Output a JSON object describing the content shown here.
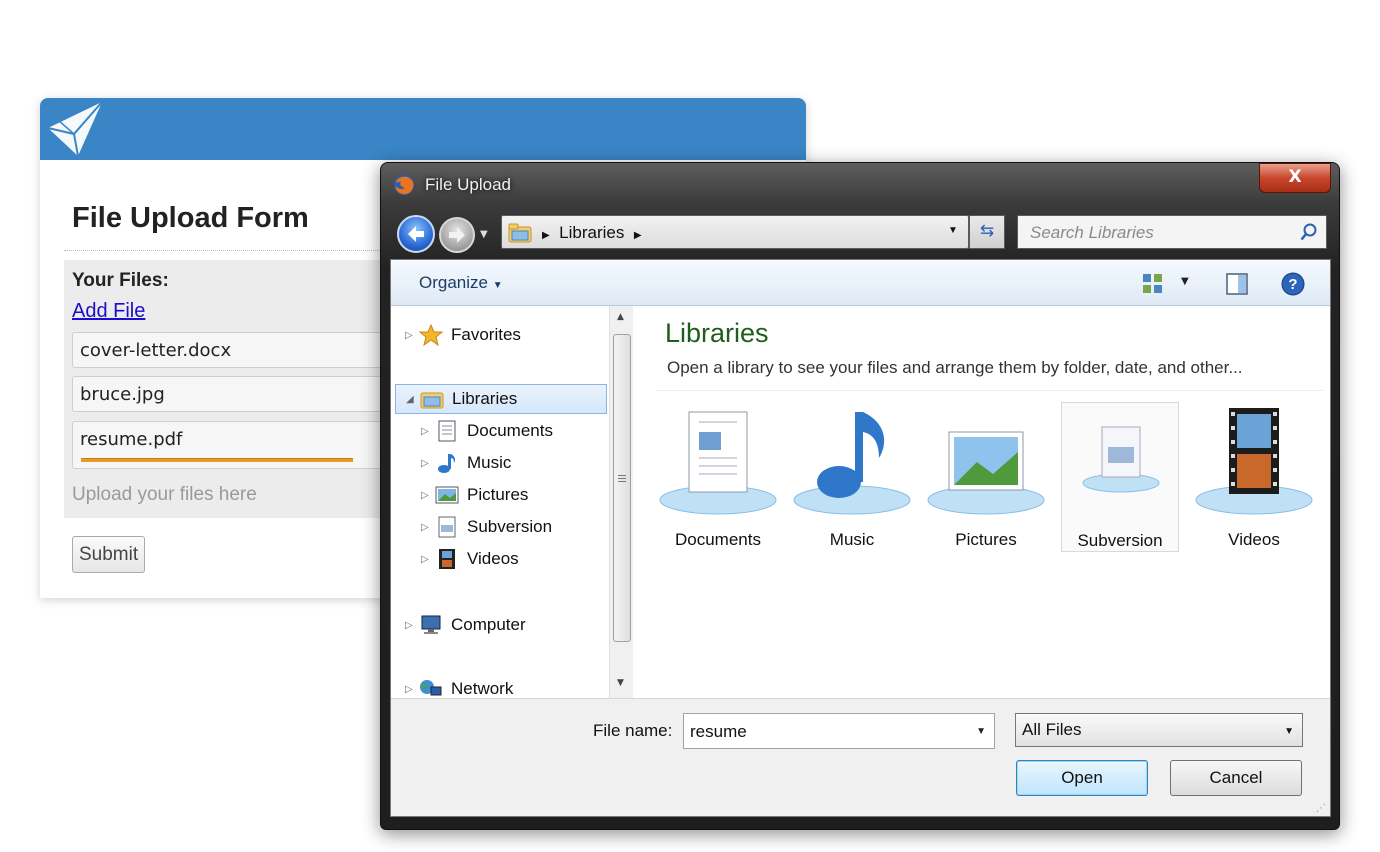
{
  "webform": {
    "title": "File Upload Form",
    "files_label": "Your Files:",
    "add_file": "Add File",
    "files": [
      "cover-letter.docx",
      "bruce.jpg",
      "resume.pdf"
    ],
    "upload_progress": 0.68,
    "hint": "Upload your files here",
    "submit": "Submit",
    "header_color": "#3a85c6"
  },
  "dialog": {
    "title": "File Upload",
    "close_glyph": "X",
    "address": "Libraries",
    "search_placeholder": "Search Libraries",
    "toolbar": {
      "organize": "Organize"
    },
    "nav": {
      "favorites": "Favorites",
      "libraries": "Libraries",
      "documents": "Documents",
      "music": "Music",
      "pictures": "Pictures",
      "subversion": "Subversion",
      "videos": "Videos",
      "computer": "Computer",
      "network": "Network"
    },
    "content": {
      "title": "Libraries",
      "description": "Open a library to see your files and arrange them by folder, date, and other...",
      "tiles": [
        "Documents",
        "Music",
        "Pictures",
        "Subversion",
        "Videos"
      ]
    },
    "footer": {
      "file_name_label": "File name:",
      "file_name_value": "resume",
      "file_type": "All Files",
      "open": "Open",
      "cancel": "Cancel"
    }
  }
}
